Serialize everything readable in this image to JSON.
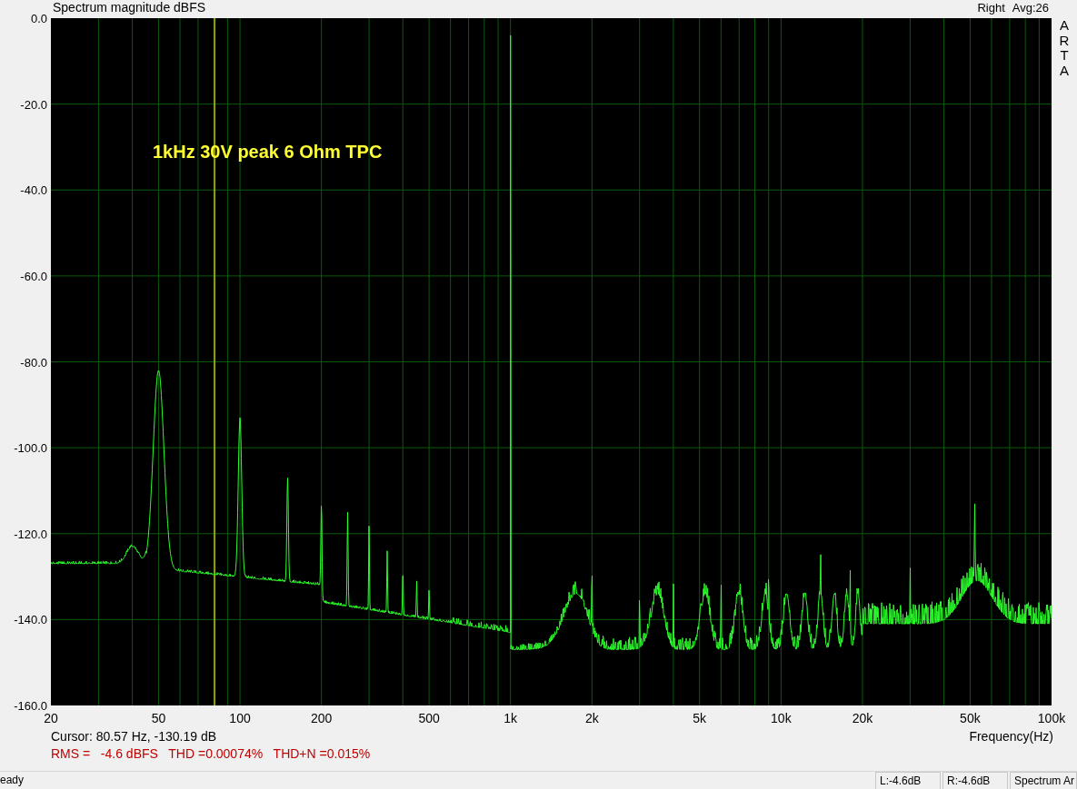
{
  "header": {
    "title": "Spectrum magnitude dBFS",
    "channel": "Right",
    "average": "Avg:26"
  },
  "side_label": "ARTA",
  "plot": {
    "annotation": "1kHz 30V peak 6 Ohm TPC",
    "y_axis_labels": [
      "0.0",
      "-20.0",
      "-40.0",
      "-60.0",
      "-80.0",
      "-100.0",
      "-120.0",
      "-140.0",
      "-160.0"
    ],
    "x_axis_labels": [
      "20",
      "50",
      "100",
      "200",
      "500",
      "1k",
      "2k",
      "5k",
      "10k",
      "20k",
      "50k",
      "100k"
    ],
    "x_axis_title": "Frequency(Hz)"
  },
  "readout": {
    "cursor": "Cursor: 80.57 Hz, -130.19 dB",
    "measurements": "RMS =   -4.6 dBFS   THD =0.00074%   THD+N =0.015%"
  },
  "status_bar": [
    "eady",
    "L:-4.6dB",
    "R:-4.6dB",
    "Spectrum Ar"
  ]
}
